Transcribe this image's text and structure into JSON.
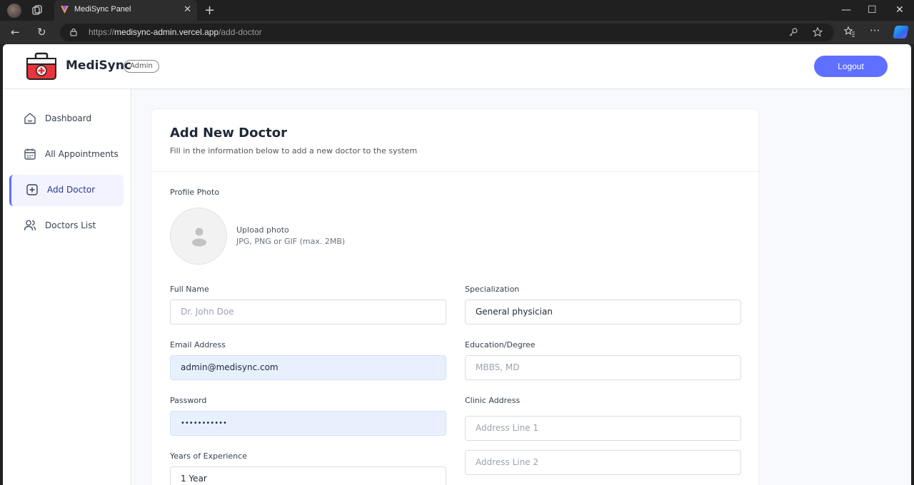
{
  "browser": {
    "tab_title": "MediSync Panel",
    "url_scheme": "https://",
    "url_host": "medisync-admin.vercel.app",
    "url_path": "/add-doctor",
    "new_tab_symbol": "+",
    "close_symbol": "✕",
    "minimize_symbol": "—",
    "maximize_symbol": "☐",
    "window_close_symbol": "✕",
    "back_symbol": "←",
    "reload_symbol": "↻",
    "more_symbol": "···"
  },
  "header": {
    "brand": "MediSync",
    "role_badge": "Admin",
    "logout_label": "Logout"
  },
  "sidebar": {
    "items": [
      {
        "label": "Dashboard",
        "icon": "home-icon",
        "active": false
      },
      {
        "label": "All Appointments",
        "icon": "calendar-icon",
        "active": false
      },
      {
        "label": "Add Doctor",
        "icon": "add-square-icon",
        "active": true
      },
      {
        "label": "Doctors List",
        "icon": "people-icon",
        "active": false
      }
    ]
  },
  "form": {
    "title": "Add New Doctor",
    "subtitle": "Fill in the information below to add a new doctor to the system",
    "photo": {
      "label": "Profile Photo",
      "upload_title": "Upload photo",
      "upload_hint": "JPG, PNG or GIF (max. 2MB)"
    },
    "full_name": {
      "label": "Full Name",
      "placeholder": "Dr. John Doe",
      "value": ""
    },
    "specialization": {
      "label": "Specialization",
      "value": "General physician"
    },
    "email": {
      "label": "Email Address",
      "value": "admin@medisync.com"
    },
    "education": {
      "label": "Education/Degree",
      "placeholder": "MBBS, MD",
      "value": ""
    },
    "password": {
      "label": "Password",
      "value": "•••••••••••"
    },
    "clinic": {
      "label": "Clinic Address",
      "line1_placeholder": "Address Line 1",
      "line2_placeholder": "Address Line 2"
    },
    "experience": {
      "label": "Years of Experience",
      "value": "1 Year"
    }
  },
  "colors": {
    "accent": "#5f6fff",
    "autofill": "#e8f0fe",
    "active_nav_bg": "#f2f3ff"
  }
}
